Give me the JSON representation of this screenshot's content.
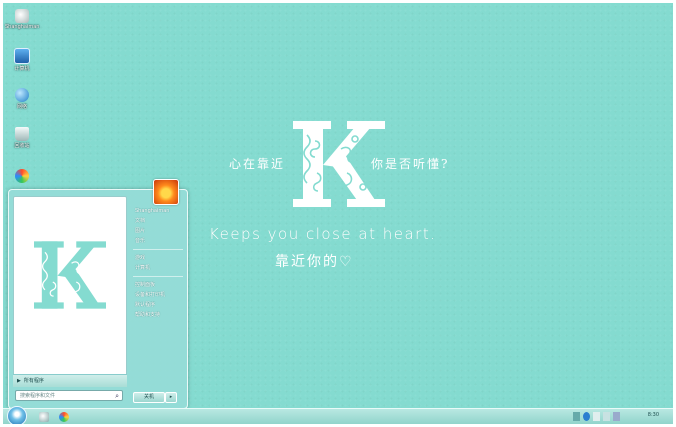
{
  "desktop": {
    "icons": [
      {
        "label": "Shanghaiman",
        "icon": "user-folder-icon",
        "color": "#e0e0e0"
      },
      {
        "label": "计算机",
        "icon": "computer-icon",
        "color": "#2a7fd0"
      },
      {
        "label": "网络",
        "icon": "network-globe-icon",
        "color": "#2aa0e0"
      },
      {
        "label": "回收站",
        "icon": "recycle-bin-icon",
        "color": "#d8e6e6"
      },
      {
        "label": "",
        "icon": "browser-icon",
        "color": "#ff8a1c"
      }
    ]
  },
  "wallpaper": {
    "left_text": "心在靠近",
    "right_text": "你是否听懂?",
    "slogan_en": "Keeps you close at heart.",
    "slogan_cn": "靠近你的♡"
  },
  "start_menu": {
    "right_items": [
      {
        "label": "Shanghaiman",
        "name": "menu-user-folder"
      },
      {
        "label": "文档",
        "name": "menu-documents"
      },
      {
        "label": "图片",
        "name": "menu-pictures"
      },
      {
        "label": "音乐",
        "name": "menu-music"
      },
      {
        "label": "游戏",
        "name": "menu-games"
      },
      {
        "label": "计算机",
        "name": "menu-computer"
      },
      {
        "label": "控制面板",
        "name": "menu-control-panel"
      },
      {
        "label": "设备和打印机",
        "name": "menu-devices-printers"
      },
      {
        "label": "默认程序",
        "name": "menu-default-programs"
      },
      {
        "label": "帮助和支持",
        "name": "menu-help-support"
      }
    ],
    "all_programs": "所有程序",
    "search_placeholder": "搜索程序和文件",
    "shutdown_label": "关机"
  },
  "taskbar": {
    "clock": "8:30",
    "accent": "#84dbd0"
  }
}
